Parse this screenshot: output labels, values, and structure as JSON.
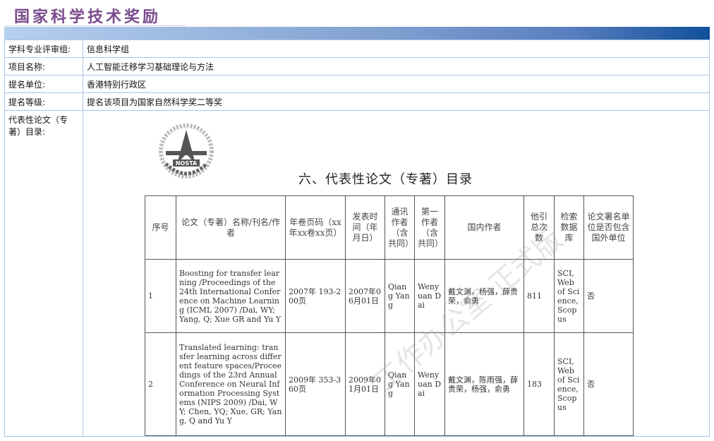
{
  "header": {
    "title": "国家科学技术奖励"
  },
  "info": [
    {
      "label": "学科专业评审组:",
      "value": "信息科学组"
    },
    {
      "label": "项目名称:",
      "value": "人工智能迁移学习基础理论与方法"
    },
    {
      "label": "提名单位:",
      "value": "香港特别行政区"
    },
    {
      "label": "提名等级:",
      "value": "提名该项目为国家自然科学奖二等奖"
    },
    {
      "label": "代表性论文（专著）目录:"
    }
  ],
  "document": {
    "logo_text": "国家科学技术奖励工作办公室 NOSTA",
    "title": "六、代表性论文（专著）目录",
    "watermark": "工作办公室 正式版",
    "columns": [
      "序号",
      "论文（专著）名称/刊名/作者",
      "年卷页码（xx年xx卷xx页）",
      "发表时间（年月日）",
      "通讯作者（含共同）",
      "第一作者（含共同）",
      "国内作者",
      "他引总次数",
      "检索数据库",
      "论文署名单位是否包含国外单位"
    ],
    "rows": [
      [
        "1",
        "Boosting for transfer learning /Proceedings of the 24th International Conference on Machine Learning (ICML 2007) /Dai, WY; Yang, Q; Xue GR and Yu Y",
        "2007年 193-200页",
        "2007年06月01日",
        "Qiang Yang",
        "Wenyuan Dai",
        "戴文渊，杨强，薛贵荣，俞勇",
        "811",
        "SCI, Web of Science, Scopus",
        "否"
      ],
      [
        "2",
        "Translated learning: transfer learning across different feature spaces/Proceedings of the 23rd Annual Conference on Neural Information Processing Systems (NIPS 2009) /Dai, WY; Chen, YQ; Xue, GR; Yang, Q and Yu Y",
        "2009年 353-360页",
        "2009年01月01日",
        "Qiang Yang",
        "Wenyuan Dai",
        "戴文渊，陈雨强，薛贵荣，杨强，俞勇",
        "183",
        "SCI, Web of Science, Scopus",
        "否"
      ]
    ]
  }
}
